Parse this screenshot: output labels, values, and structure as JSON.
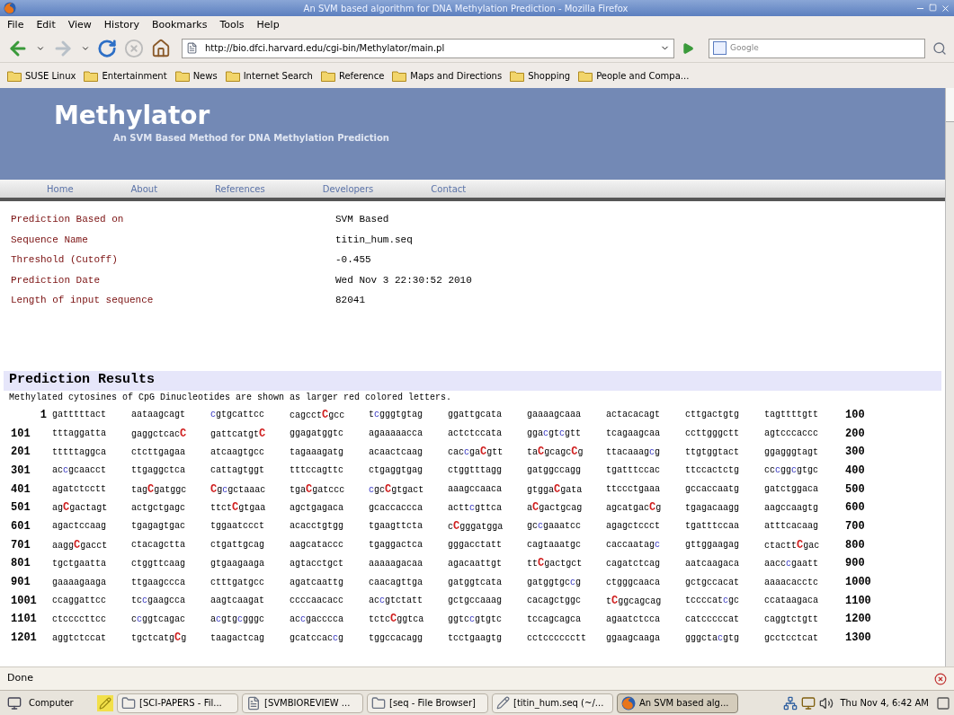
{
  "window": {
    "title": "An SVM based algorithm for DNA Methylation Prediction - Mozilla Firefox"
  },
  "menu_bar": [
    "File",
    "Edit",
    "View",
    "History",
    "Bookmarks",
    "Tools",
    "Help"
  ],
  "address_bar": {
    "value": "http://bio.dfci.harvard.edu/cgi-bin/Methylator/main.pl"
  },
  "search": {
    "placeholder": "Google"
  },
  "bookmarks": [
    "SUSE Linux",
    "Entertainment",
    "News",
    "Internet Search",
    "Reference",
    "Maps and Directions",
    "Shopping",
    "People and Compa..."
  ],
  "site": {
    "title": "Methylator",
    "subtitle": "An SVM Based Method for DNA Methylation Prediction",
    "nav": [
      "Home",
      "About",
      "References",
      "Developers",
      "Contact"
    ]
  },
  "info": [
    {
      "label": "Prediction Based on",
      "value": "SVM Based"
    },
    {
      "label": "Sequence Name",
      "value": "titin_hum.seq"
    },
    {
      "label": "Threshold (Cutoff)",
      "value": "-0.455"
    },
    {
      "label": "Prediction Date",
      "value": "Wed Nov 3 22:30:52 2010"
    },
    {
      "label": "Length of input sequence",
      "value": "82041"
    }
  ],
  "results": {
    "heading": "Prediction Results",
    "note": "Methylated cytosines of CpG Dinucleotides are shown as larger red colored letters.",
    "rows": [
      {
        "start": "1",
        "end": "100",
        "blocks": [
          [
            "gatttttact"
          ],
          [
            "aataagcagt"
          ],
          [
            {
              "text": "c",
              "kind": "unmethylated"
            },
            "gtgcattcc"
          ],
          [
            "cagcct",
            {
              "text": "C",
              "kind": "methylated"
            },
            "gcc"
          ],
          [
            "t",
            {
              "text": "c",
              "kind": "unmethylated"
            },
            "gggtgtag"
          ],
          [
            "ggattgcata"
          ],
          [
            "gaaaagcaaa"
          ],
          [
            "actacacagt"
          ],
          [
            "cttgactgtg"
          ],
          [
            "tagttttgtt"
          ]
        ]
      },
      {
        "start": "101",
        "end": "200",
        "blocks": [
          [
            "tttaggatta"
          ],
          [
            "gaggctcac",
            {
              "text": "C",
              "kind": "methylated"
            }
          ],
          [
            "gattcatgt",
            {
              "text": "C",
              "kind": "methylated"
            }
          ],
          [
            "ggagatggtc"
          ],
          [
            "agaaaaacca"
          ],
          [
            "actctccata"
          ],
          [
            "gga",
            {
              "text": "c",
              "kind": "unmethylated"
            },
            "gt",
            {
              "text": "c",
              "kind": "unmethylated"
            },
            "gtt"
          ],
          [
            "tcagaagcaa"
          ],
          [
            "ccttgggctt"
          ],
          [
            "agtcccaccc"
          ]
        ]
      },
      {
        "start": "201",
        "end": "300",
        "blocks": [
          [
            "tttttaggca"
          ],
          [
            "ctcttgagaa"
          ],
          [
            "atcaagtgcc"
          ],
          [
            "tagaaagatg"
          ],
          [
            "acaactcaag"
          ],
          [
            "cac",
            {
              "text": "c",
              "kind": "unmethylated"
            },
            "ga",
            {
              "text": "C",
              "kind": "methylated"
            },
            "gtt"
          ],
          [
            "ta",
            {
              "text": "C",
              "kind": "methylated"
            },
            "gcagc",
            {
              "text": "C",
              "kind": "methylated"
            },
            "g"
          ],
          [
            "ttacaaag",
            {
              "text": "c",
              "kind": "unmethylated"
            },
            "g"
          ],
          [
            "ttgtggtact"
          ],
          [
            "ggagggtagt"
          ]
        ]
      },
      {
        "start": "301",
        "end": "400",
        "blocks": [
          [
            "ac",
            {
              "text": "c",
              "kind": "unmethylated"
            },
            "gcaacct"
          ],
          [
            "ttgaggctca"
          ],
          [
            "cattagtggt"
          ],
          [
            "tttccagttc"
          ],
          [
            "ctgaggtgag"
          ],
          [
            "ctggtttagg"
          ],
          [
            "gatggccagg"
          ],
          [
            "tgatttccac"
          ],
          [
            "ttccactctg"
          ],
          [
            "cc",
            {
              "text": "c",
              "kind": "unmethylated"
            },
            "gg",
            {
              "text": "c",
              "kind": "unmethylated"
            },
            "gtgc"
          ]
        ]
      },
      {
        "start": "401",
        "end": "500",
        "blocks": [
          [
            "agatctcctt"
          ],
          [
            "tag",
            {
              "text": "C",
              "kind": "methylated"
            },
            "gatggc"
          ],
          [
            {
              "text": "C",
              "kind": "methylated"
            },
            "g",
            {
              "text": "c",
              "kind": "unmethylated"
            },
            "gctaaac"
          ],
          [
            "tga",
            {
              "text": "C",
              "kind": "methylated"
            },
            "gatccc"
          ],
          [
            {
              "text": "c",
              "kind": "unmethylated"
            },
            "gc",
            {
              "text": "C",
              "kind": "methylated"
            },
            "gtgact"
          ],
          [
            "aaagccaaca"
          ],
          [
            "gtgga",
            {
              "text": "C",
              "kind": "methylated"
            },
            "gata"
          ],
          [
            "ttccctgaaa"
          ],
          [
            "gccaccaatg"
          ],
          [
            "gatctggaca"
          ]
        ]
      },
      {
        "start": "501",
        "end": "600",
        "blocks": [
          [
            "ag",
            {
              "text": "C",
              "kind": "methylated"
            },
            "gactagt"
          ],
          [
            "actgctgagc"
          ],
          [
            "ttct",
            {
              "text": "C",
              "kind": "methylated"
            },
            "gtgaa"
          ],
          [
            "agctgagaca"
          ],
          [
            "gcaccaccca"
          ],
          [
            "actt",
            {
              "text": "c",
              "kind": "unmethylated"
            },
            "gttca"
          ],
          [
            "a",
            {
              "text": "C",
              "kind": "methylated"
            },
            "gactgcag"
          ],
          [
            "agcatgac",
            {
              "text": "C",
              "kind": "methylated"
            },
            "g"
          ],
          [
            "tgagacaagg"
          ],
          [
            "aagccaagtg"
          ]
        ]
      },
      {
        "start": "601",
        "end": "700",
        "blocks": [
          [
            "agactccaag"
          ],
          [
            "tgagagtgac"
          ],
          [
            "tggaatccct"
          ],
          [
            "acacctgtgg"
          ],
          [
            "tgaagttcta"
          ],
          [
            "c",
            {
              "text": "C",
              "kind": "methylated"
            },
            "gggatgga"
          ],
          [
            "gc",
            {
              "text": "c",
              "kind": "unmethylated"
            },
            "gaaatcc"
          ],
          [
            "agagctccct"
          ],
          [
            "tgatttccaa"
          ],
          [
            "atttcacaag"
          ]
        ]
      },
      {
        "start": "701",
        "end": "800",
        "blocks": [
          [
            "aagg",
            {
              "text": "C",
              "kind": "methylated"
            },
            "gacct"
          ],
          [
            "ctacagctta"
          ],
          [
            "ctgattgcag"
          ],
          [
            "aagcataccc"
          ],
          [
            "tgaggactca"
          ],
          [
            "gggacctatt"
          ],
          [
            "cagtaaatgc"
          ],
          [
            "caccaatag",
            {
              "text": "c",
              "kind": "unmethylated"
            }
          ],
          [
            "gttggaagag"
          ],
          [
            "ctactt",
            {
              "text": "C",
              "kind": "methylated"
            },
            "gac"
          ]
        ]
      },
      {
        "start": "801",
        "end": "900",
        "blocks": [
          [
            "tgctgaatta"
          ],
          [
            "ctggttcaag"
          ],
          [
            "gtgaagaaga"
          ],
          [
            "agtacctgct"
          ],
          [
            "aaaaagacaa"
          ],
          [
            "agacaattgt"
          ],
          [
            "tt",
            {
              "text": "C",
              "kind": "methylated"
            },
            "gactgct"
          ],
          [
            "cagatctcag"
          ],
          [
            "aatcaagaca"
          ],
          [
            "aacc",
            {
              "text": "c",
              "kind": "unmethylated"
            },
            "gaatt"
          ]
        ]
      },
      {
        "start": "901",
        "end": "1000",
        "blocks": [
          [
            "gaaaagaaga"
          ],
          [
            "ttgaagccca"
          ],
          [
            "ctttgatgcc"
          ],
          [
            "agatcaattg"
          ],
          [
            "caacagttga"
          ],
          [
            "gatggtcata"
          ],
          [
            "gatggtgc",
            {
              "text": "c",
              "kind": "unmethylated"
            },
            "g"
          ],
          [
            "ctgggcaaca"
          ],
          [
            "gctgccacat"
          ],
          [
            "aaaacacctc"
          ]
        ]
      },
      {
        "start": "1001",
        "end": "1100",
        "blocks": [
          [
            "ccaggattcc"
          ],
          [
            "tc",
            {
              "text": "c",
              "kind": "unmethylated"
            },
            "gaagcca"
          ],
          [
            "aagtcaagat"
          ],
          [
            "ccccaacacc"
          ],
          [
            "ac",
            {
              "text": "c",
              "kind": "unmethylated"
            },
            "gtctatt"
          ],
          [
            "gctgccaaag"
          ],
          [
            "cacagctggc"
          ],
          [
            "t",
            {
              "text": "C",
              "kind": "methylated"
            },
            "ggcagcag"
          ],
          [
            "tccccat",
            {
              "text": "c",
              "kind": "unmethylated"
            },
            "gc"
          ],
          [
            "ccataagaca"
          ]
        ]
      },
      {
        "start": "1101",
        "end": "1200",
        "blocks": [
          [
            "ctccccttcc"
          ],
          [
            "c",
            {
              "text": "c",
              "kind": "unmethylated"
            },
            "ggtcagac"
          ],
          [
            "a",
            {
              "text": "c",
              "kind": "unmethylated"
            },
            "gtg",
            {
              "text": "c",
              "kind": "unmethylated"
            },
            "gggc"
          ],
          [
            "ac",
            {
              "text": "c",
              "kind": "unmethylated"
            },
            "gacccca"
          ],
          [
            "tctc",
            {
              "text": "C",
              "kind": "methylated"
            },
            "ggtca"
          ],
          [
            "ggtc",
            {
              "text": "c",
              "kind": "unmethylated"
            },
            "gtgtc"
          ],
          [
            "tccagcagca"
          ],
          [
            "agaatctcca"
          ],
          [
            "catcccccat"
          ],
          [
            "caggtctgtt"
          ]
        ]
      },
      {
        "start": "1201",
        "end": "1300",
        "blocks": [
          [
            "aggtctccat"
          ],
          [
            "tgctcatg",
            {
              "text": "C",
              "kind": "methylated"
            },
            "g"
          ],
          [
            "taagactcag"
          ],
          [
            "gcatccac",
            {
              "text": "c",
              "kind": "unmethylated"
            },
            "g"
          ],
          [
            "tggccacagg"
          ],
          [
            "tcctgaagtg"
          ],
          [
            "cctcccccctt"
          ],
          [
            "ggaagcaaga"
          ],
          [
            "gggcta",
            {
              "text": "c",
              "kind": "unmethylated"
            },
            "gtg"
          ],
          [
            "gcctcctcat"
          ]
        ]
      }
    ]
  },
  "status_bar": {
    "text": "Done"
  },
  "taskbar": {
    "start": "Computer",
    "tasks": [
      {
        "label": "[SCI-PAPERS - Fil...",
        "kind": "folder",
        "selected": false
      },
      {
        "label": "[SVMBIOREVIEW ...",
        "kind": "document",
        "selected": false
      },
      {
        "label": "[seq - File Browser]",
        "kind": "folder",
        "selected": false
      },
      {
        "label": "[titin_hum.seq (~/...",
        "kind": "editor",
        "selected": false
      },
      {
        "label": "An SVM based alg...",
        "kind": "browser",
        "selected": true
      }
    ],
    "clock": "Thu Nov 4, 6:42 AM"
  }
}
